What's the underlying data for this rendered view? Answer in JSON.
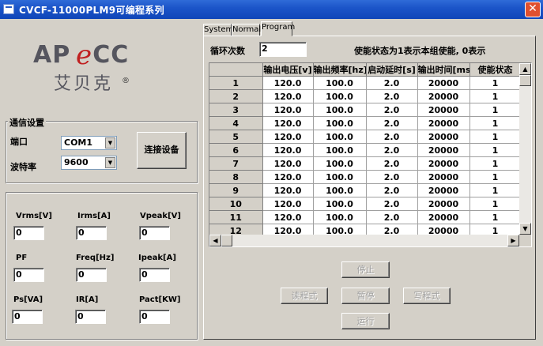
{
  "window": {
    "title": "CVCF-11000PLM9可编程系列",
    "close_glyph": "✕"
  },
  "logo": {
    "brand_prefix": "AP",
    "brand_e": "e",
    "brand_suffix": "CC",
    "cn_name": "艾贝克",
    "registered": "®"
  },
  "comm": {
    "group_title": "通信设置",
    "port_label": "端口",
    "port_value": "COM1",
    "baud_label": "波特率",
    "baud_value": "9600",
    "connect_label": "连接设备"
  },
  "measurements": [
    {
      "label": "Vrms[V]",
      "value": "0"
    },
    {
      "label": "Irms[A]",
      "value": "0"
    },
    {
      "label": "Vpeak[V]",
      "value": "0"
    },
    {
      "label": "PF",
      "value": "0"
    },
    {
      "label": "Freq[Hz]",
      "value": "0"
    },
    {
      "label": "Ipeak[A]",
      "value": "0"
    },
    {
      "label": "Ps[VA]",
      "value": "0"
    },
    {
      "label": "IR[A]",
      "value": "0"
    },
    {
      "label": "Pact[KW]",
      "value": "0"
    }
  ],
  "tabs": [
    {
      "label": "System",
      "active": false
    },
    {
      "label": "Normal",
      "active": false
    },
    {
      "label": "Program",
      "active": true
    }
  ],
  "program": {
    "loop_label": "循环次数",
    "loop_value": "2",
    "enable_note": "使能状态为1表示本组使能, 0表示",
    "columns": [
      "输出电压[v]",
      "输出频率[hz]",
      "启动延时[s]",
      "输出时间[ms]",
      "使能状态"
    ],
    "rows": [
      {
        "n": "1",
        "v": "120.0",
        "f": "100.0",
        "d": "2.0",
        "t": "20000",
        "e": "1"
      },
      {
        "n": "2",
        "v": "120.0",
        "f": "100.0",
        "d": "2.0",
        "t": "20000",
        "e": "1"
      },
      {
        "n": "3",
        "v": "120.0",
        "f": "100.0",
        "d": "2.0",
        "t": "20000",
        "e": "1"
      },
      {
        "n": "4",
        "v": "120.0",
        "f": "100.0",
        "d": "2.0",
        "t": "20000",
        "e": "1"
      },
      {
        "n": "5",
        "v": "120.0",
        "f": "100.0",
        "d": "2.0",
        "t": "20000",
        "e": "1"
      },
      {
        "n": "6",
        "v": "120.0",
        "f": "100.0",
        "d": "2.0",
        "t": "20000",
        "e": "1"
      },
      {
        "n": "7",
        "v": "120.0",
        "f": "100.0",
        "d": "2.0",
        "t": "20000",
        "e": "1"
      },
      {
        "n": "8",
        "v": "120.0",
        "f": "100.0",
        "d": "2.0",
        "t": "20000",
        "e": "1"
      },
      {
        "n": "9",
        "v": "120.0",
        "f": "100.0",
        "d": "2.0",
        "t": "20000",
        "e": "1"
      },
      {
        "n": "10",
        "v": "120.0",
        "f": "100.0",
        "d": "2.0",
        "t": "20000",
        "e": "1"
      },
      {
        "n": "11",
        "v": "120.0",
        "f": "100.0",
        "d": "2.0",
        "t": "20000",
        "e": "1"
      },
      {
        "n": "12",
        "v": "120.0",
        "f": "100.0",
        "d": "2.0",
        "t": "20000",
        "e": "1"
      }
    ],
    "buttons": {
      "stop": "停止",
      "read": "读程式",
      "pause": "暂停",
      "write": "写程式",
      "run": "运行"
    }
  }
}
